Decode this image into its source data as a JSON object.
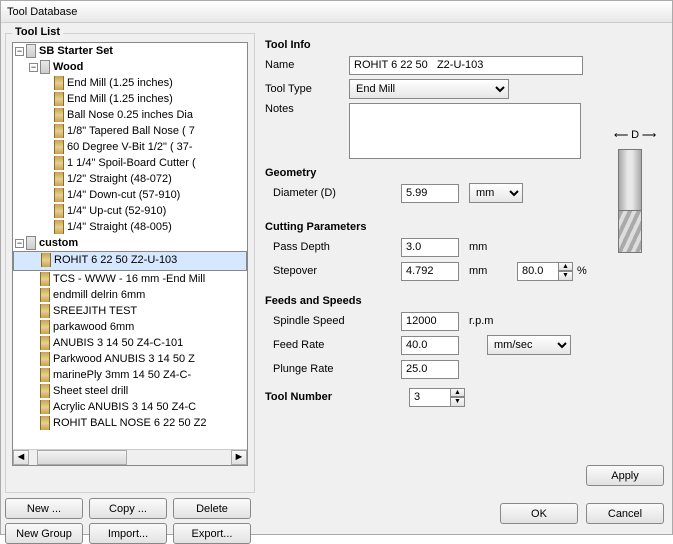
{
  "window": {
    "title": "Tool Database"
  },
  "toolList": {
    "label": "Tool List",
    "groups": [
      {
        "name": "SB Starter Set",
        "expanded": true,
        "children": [
          {
            "name": "Wood",
            "expanded": true,
            "tools": [
              "End Mill (1.25 inches)",
              "End Mill (1.25 inches)",
              "Ball Nose 0.25 inches Dia",
              "1/8\" Tapered Ball Nose  ( 7",
              "60 Degree V-Bit 1/2\"  ( 37-",
              "1 1/4\" Spoil-Board Cutter (",
              "1/2\" Straight  (48-072)",
              "1/4\" Down-cut (57-910)",
              "1/4\" Up-cut (52-910)",
              "1/4\" Straight  (48-005)"
            ]
          }
        ]
      },
      {
        "name": "custom",
        "expanded": true,
        "tools": [
          "ROHIT 6 22 50   Z2-U-103",
          "TCS - WWW - 16 mm -End Mill",
          "endmill delrin 6mm",
          "SREEJITH TEST",
          "parkawood 6mm",
          "ANUBIS 3  14 50    Z4-C-101",
          "Parkwood ANUBIS 3  14 50    Z",
          "marinePly 3mm  14 50    Z4-C-",
          "Sheet steel drill",
          "Acrylic ANUBIS 3  14 50    Z4-C",
          "ROHIT BALL NOSE 6 22 50   Z2"
        ]
      }
    ],
    "selected": "ROHIT 6 22 50   Z2-U-103"
  },
  "buttons": {
    "new": "New ...",
    "copy": "Copy ...",
    "delete": "Delete",
    "newGroup": "New Group",
    "import": "Import...",
    "export": "Export...",
    "apply": "Apply",
    "ok": "OK",
    "cancel": "Cancel"
  },
  "info": {
    "heading": "Tool Info",
    "nameLabel": "Name",
    "name": "ROHIT 6 22 50   Z2-U-103",
    "typeLabel": "Tool Type",
    "type": "End Mill",
    "notesLabel": "Notes",
    "notes": "",
    "geometryHeading": "Geometry",
    "diameterLabel": "Diameter (D)",
    "diameter": "5.99",
    "diameterUnit": "mm",
    "cuttingHeading": "Cutting Parameters",
    "passDepthLabel": "Pass Depth",
    "passDepth": "3.0",
    "passDepthUnit": "mm",
    "stepoverLabel": "Stepover",
    "stepover": "4.792",
    "stepoverUnit": "mm",
    "stepoverPct": "80.0",
    "pct": "%",
    "feedsHeading": "Feeds and Speeds",
    "spindleLabel": "Spindle Speed",
    "spindle": "12000",
    "spindleUnit": "r.p.m",
    "feedRateLabel": "Feed Rate",
    "feedRate": "40.0",
    "plungeLabel": "Plunge Rate",
    "plunge": "25.0",
    "rateUnit": "mm/sec",
    "toolNumberLabel": "Tool Number",
    "toolNumber": "3",
    "dSymbol": "D"
  }
}
